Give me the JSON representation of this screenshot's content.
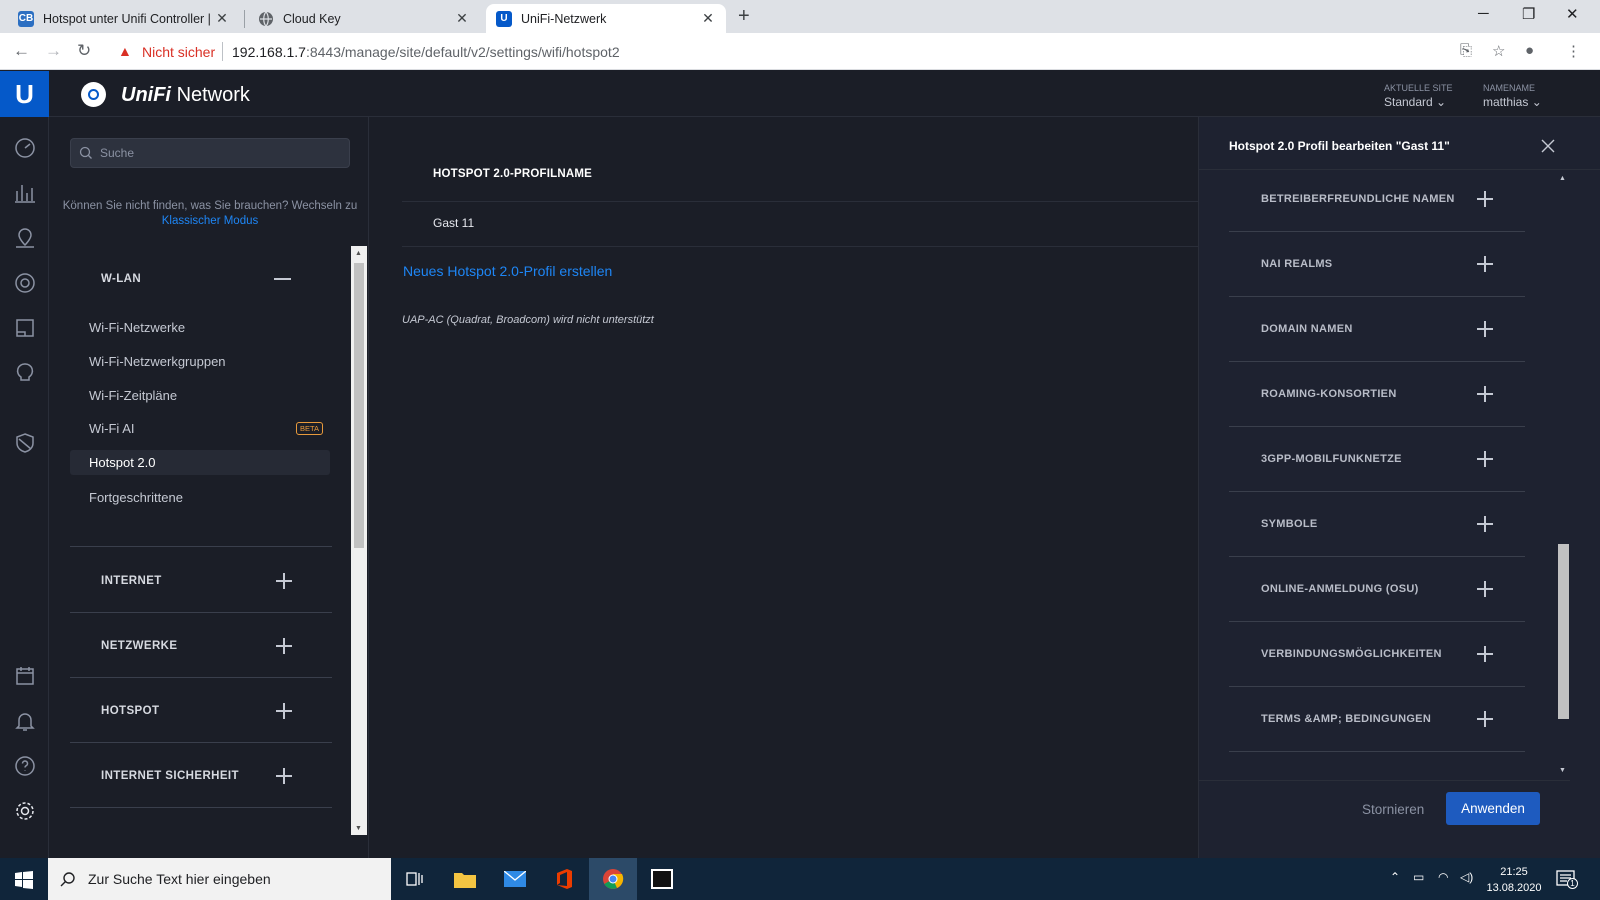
{
  "browser": {
    "tabs": [
      {
        "title": "Hotspot unter Unifi Controller | C",
        "icon": "cb-favicon"
      },
      {
        "title": "Cloud Key",
        "icon": "globe-icon"
      },
      {
        "title": "UniFi-Netzwerk",
        "icon": "unifi-favicon"
      }
    ],
    "security_label": "Nicht sicher",
    "url_host": "192.168.1.7",
    "url_path": ":8443/manage/site/default/v2/settings/wifi/hotspot2"
  },
  "app": {
    "brand_prefix": "UniFi",
    "brand_suffix": "Network",
    "site_label": "AKTUELLE SITE",
    "site_value": "Standard",
    "user_label": "NAMENAME",
    "user_value": "matthias"
  },
  "settings_nav": {
    "search_placeholder": "Suche",
    "hint_text": "Können Sie nicht finden, was Sie brauchen? Wechseln zu",
    "hint_link": "Klassischer Modus",
    "wlan_section": "W-LAN",
    "wlan_items": [
      {
        "label": "Wi-Fi-Netzwerke"
      },
      {
        "label": "Wi-Fi-Netzwerkgruppen"
      },
      {
        "label": "Wi-Fi-Zeitpläne"
      },
      {
        "label": "Wi-Fi AI",
        "badge": "BETA"
      },
      {
        "label": "Hotspot 2.0",
        "selected": true
      },
      {
        "label": "Fortgeschrittene"
      }
    ],
    "sections": [
      "INTERNET",
      "NETZWERKE",
      "HOTSPOT",
      "INTERNET SICHERHEIT"
    ]
  },
  "main": {
    "column_header": "HOTSPOT 2.0-PROFILNAME",
    "rows": [
      "Gast 11"
    ],
    "create_link": "Neues Hotspot 2.0-Profil erstellen",
    "note": "UAP-AC (Quadrat, Broadcom) wird nicht unterstützt"
  },
  "drawer": {
    "title": "Hotspot 2.0 Profil bearbeiten \"Gast 11\"",
    "sections": [
      "BETREIBERFREUNDLICHE NAMEN",
      "NAI REALMS",
      "DOMAIN NAMEN",
      "ROAMING-KONSORTIEN",
      "3GPP-MOBILFUNKNETZE",
      "SYMBOLE",
      "ONLINE-ANMELDUNG (OSU)",
      "VERBINDUNGSMÖGLICHKEITEN",
      "TERMS &AMP; BEDINGUNGEN"
    ],
    "cancel_label": "Stornieren",
    "apply_label": "Anwenden"
  },
  "taskbar": {
    "search_placeholder": "Zur Suche Text hier eingeben",
    "time": "21:25",
    "date": "13.08.2020",
    "notification_count": "1"
  },
  "colors": {
    "accent": "#1e86f5",
    "brand_blue": "#0559c9",
    "background": "#1b1e27",
    "drawer_bg": "#1e2230",
    "apply_button": "#1e5bbf",
    "beta_badge": "#e89a3c",
    "warning_red": "#d93025"
  }
}
